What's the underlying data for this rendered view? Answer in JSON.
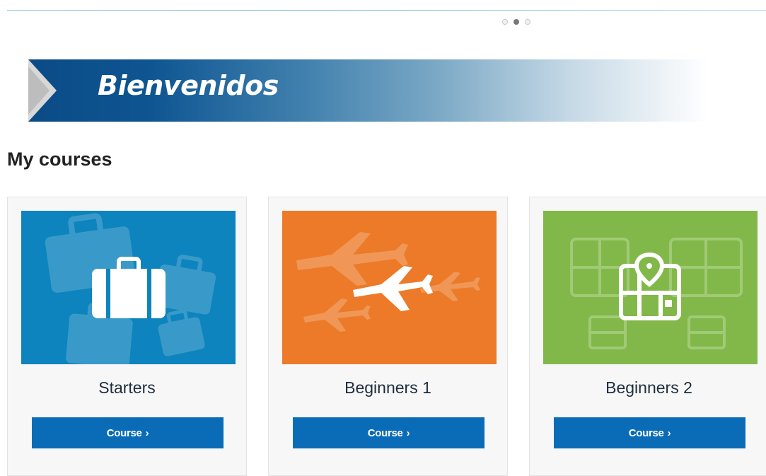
{
  "carousel": {
    "dots": 3,
    "active_index": 1
  },
  "banner": {
    "title": "Bienvenidos"
  },
  "section": {
    "title": "My courses"
  },
  "courses": [
    {
      "title": "Starters",
      "button_label": "Course",
      "button_icon": "chevron-right-icon",
      "image_icon": "suitcase-icon",
      "color": "#0d84bd"
    },
    {
      "title": "Beginners 1",
      "button_label": "Course",
      "button_icon": "chevron-right-icon",
      "image_icon": "airplane-icon",
      "color": "#ec7a28"
    },
    {
      "title": "Beginners 2",
      "button_label": "Course",
      "button_icon": "chevron-right-icon",
      "image_icon": "map-pin-icon",
      "color": "#82b849"
    }
  ],
  "colors": {
    "button": "#0a6cb7",
    "banner": "#0b4b86"
  }
}
